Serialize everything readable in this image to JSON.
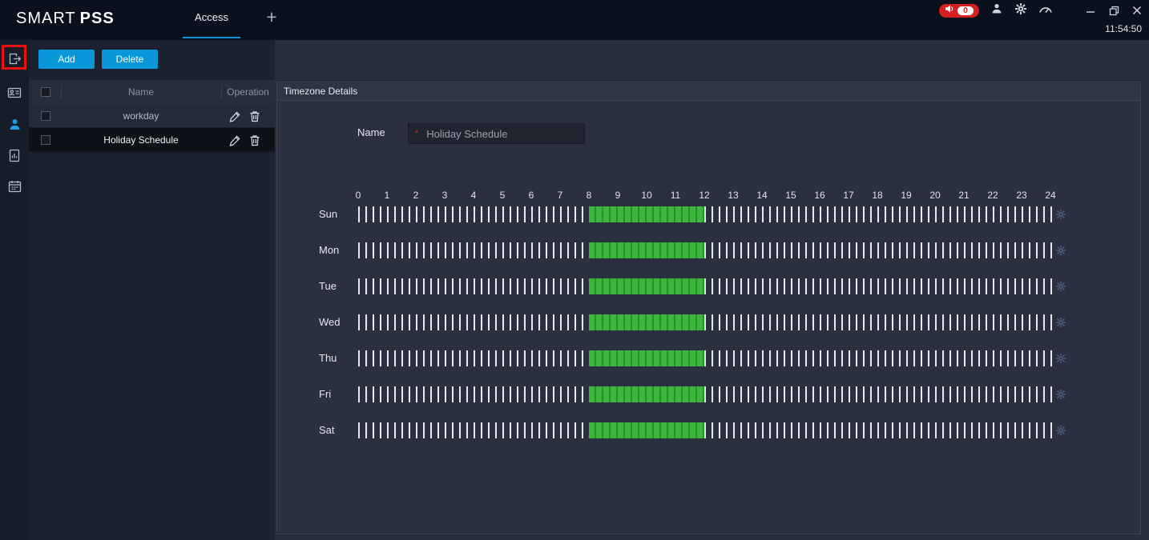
{
  "header": {
    "brand_part1": "SMART",
    "brand_part2": "PSS",
    "tab_label": "Access",
    "new_tab_label": "+",
    "notification_count": "0",
    "clock": "11:54:50"
  },
  "colors": {
    "accent_blue": "#0a97d9",
    "schedule_green": "#3db63d",
    "badge_red": "#d42020",
    "highlight_red": "#e81111"
  },
  "sidebar": {
    "items": [
      {
        "id": "timezone-config",
        "highlighted": true,
        "active": false
      },
      {
        "id": "id-card",
        "highlighted": false,
        "active": false
      },
      {
        "id": "user",
        "highlighted": false,
        "active": true
      },
      {
        "id": "report",
        "highlighted": false,
        "active": false
      },
      {
        "id": "calendar",
        "highlighted": false,
        "active": false
      }
    ]
  },
  "list_panel": {
    "buttons": {
      "add": "Add",
      "delete": "Delete"
    },
    "table": {
      "columns": {
        "name": "Name",
        "operation": "Operation"
      },
      "rows": [
        {
          "name": "workday",
          "selected": false
        },
        {
          "name": "Holiday Schedule",
          "selected": true
        }
      ]
    }
  },
  "details": {
    "title": "Timezone Details",
    "form": {
      "name_label": "Name",
      "required_marker": "*",
      "name_value": "Holiday Schedule"
    },
    "timeline": {
      "hour_labels": [
        "0",
        "1",
        "2",
        "3",
        "4",
        "5",
        "6",
        "7",
        "8",
        "9",
        "10",
        "11",
        "12",
        "13",
        "14",
        "15",
        "16",
        "17",
        "18",
        "19",
        "20",
        "21",
        "22",
        "23",
        "24"
      ],
      "days": [
        "Sun",
        "Mon",
        "Tue",
        "Wed",
        "Thu",
        "Fri",
        "Sat"
      ],
      "ticks_per_hour": 4,
      "period_start_hour": 8,
      "period_end_hour": 12
    }
  }
}
